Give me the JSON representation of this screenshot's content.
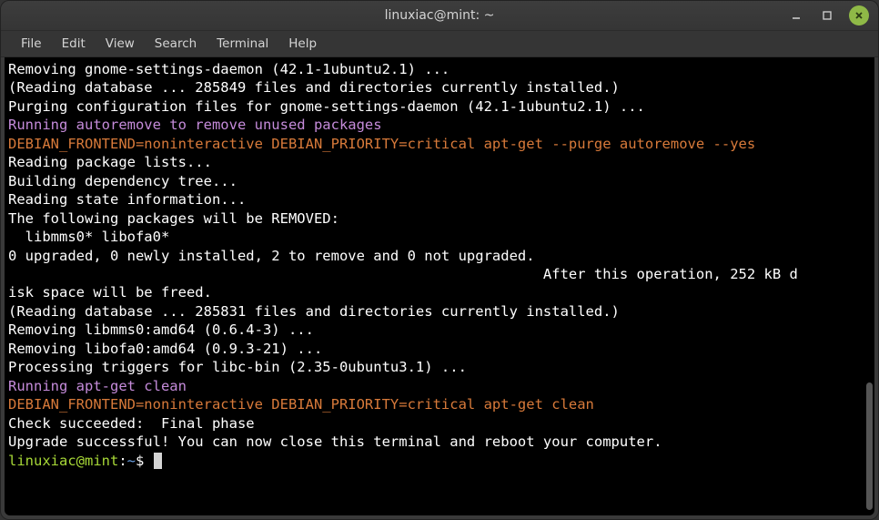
{
  "window": {
    "title": "linuxiac@mint: ~"
  },
  "menu": {
    "file": "File",
    "edit": "Edit",
    "view": "View",
    "search": "Search",
    "terminal": "Terminal",
    "help": "Help"
  },
  "terminal": {
    "lines": [
      {
        "text": "Removing gnome-settings-daemon (42.1-1ubuntu2.1) ...",
        "class": ""
      },
      {
        "text": "(Reading database ... 285849 files and directories currently installed.)",
        "class": ""
      },
      {
        "text": "Purging configuration files for gnome-settings-daemon (42.1-1ubuntu2.1) ...",
        "class": ""
      },
      {
        "text": "Running autoremove to remove unused packages",
        "class": "purple"
      },
      {
        "text": "DEBIAN_FRONTEND=noninteractive DEBIAN_PRIORITY=critical apt-get --purge autoremove --yes",
        "class": "orange"
      },
      {
        "text": "Reading package lists...",
        "class": ""
      },
      {
        "text": "Building dependency tree...",
        "class": ""
      },
      {
        "text": "Reading state information...",
        "class": ""
      },
      {
        "text": "The following packages will be REMOVED:",
        "class": ""
      },
      {
        "text": "  libmms0* libofa0*",
        "class": ""
      },
      {
        "text": "0 upgraded, 0 newly installed, 2 to remove and 0 not upgraded.",
        "class": ""
      },
      {
        "text": "                                                               After this operation, 252 kB d",
        "class": ""
      },
      {
        "text": "isk space will be freed.",
        "class": ""
      },
      {
        "text": "(Reading database ... 285831 files and directories currently installed.)",
        "class": ""
      },
      {
        "text": "Removing libmms0:amd64 (0.6.4-3) ...",
        "class": ""
      },
      {
        "text": "Removing libofa0:amd64 (0.9.3-21) ...",
        "class": ""
      },
      {
        "text": "Processing triggers for libc-bin (2.35-0ubuntu3.1) ...",
        "class": ""
      },
      {
        "text": "Running apt-get clean",
        "class": "purple"
      },
      {
        "text": "DEBIAN_FRONTEND=noninteractive DEBIAN_PRIORITY=critical apt-get clean",
        "class": "orange"
      },
      {
        "text": "Check succeeded:  Final phase",
        "class": ""
      },
      {
        "text": "Upgrade successful! You can now close this terminal and reboot your computer.",
        "class": ""
      }
    ],
    "prompt": {
      "user_host": "linuxiac@mint",
      "sep1": ":",
      "path": "~",
      "sep2": "$ "
    }
  }
}
